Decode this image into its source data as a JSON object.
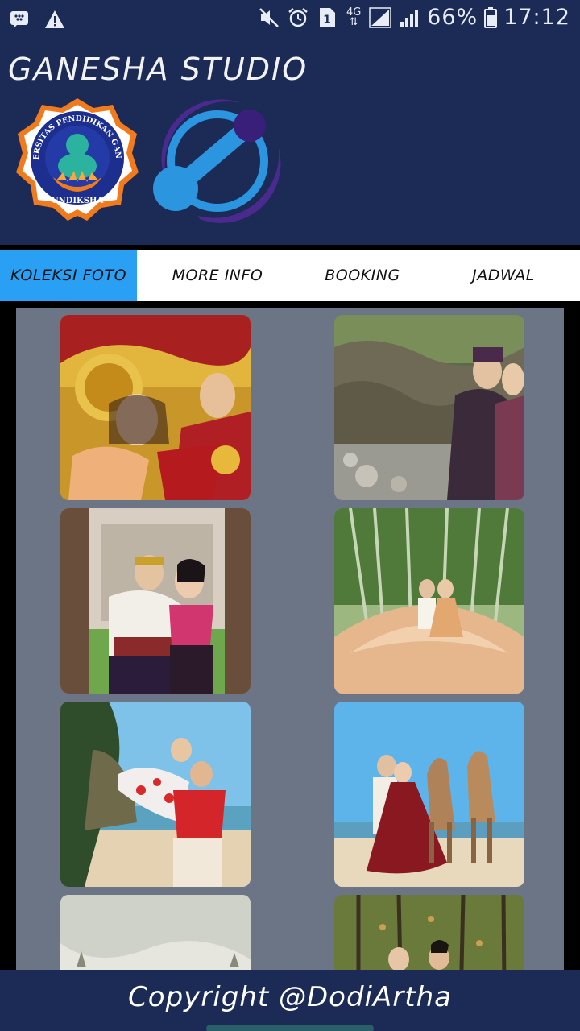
{
  "status_bar": {
    "battery_percent": "66%",
    "time": "17:12",
    "network": "4G",
    "sim_slot": "1",
    "icons": [
      "bbm-icon",
      "warning-icon",
      "mute-icon",
      "alarm-icon",
      "sim-icon",
      "signal-icon",
      "battery-icon"
    ]
  },
  "header": {
    "title": "GANESHA STUDIO",
    "logo_left": {
      "icon": "undiksha-logo",
      "ring_text": "UNIVERSITAS PENDIDIKAN GANESHA",
      "bottom_text": "UNDIKSHA"
    },
    "logo_right": {
      "icon": "app-logo"
    }
  },
  "tabs": [
    {
      "label": "KOLEKSI FOTO",
      "active": true
    },
    {
      "label": "MORE INFO",
      "active": false
    },
    {
      "label": "BOOKING",
      "active": false
    },
    {
      "label": "JADWAL",
      "active": false
    }
  ],
  "gallery": {
    "photos": [
      {
        "name": "balinese-couple-gold-costume"
      },
      {
        "name": "couple-rocky-river"
      },
      {
        "name": "couple-temple-gate"
      },
      {
        "name": "couple-bamboo-forest-dress"
      },
      {
        "name": "couple-beach-cliff"
      },
      {
        "name": "couple-beach-camels"
      },
      {
        "name": "photo-sky-trees"
      },
      {
        "name": "couple-autumn-forest"
      }
    ]
  },
  "footer": {
    "copyright": "Copyright @DodiArtha"
  },
  "colors": {
    "header_bg": "#1b2b55",
    "tab_active": "#2aa0f5",
    "gallery_bg": "#6c7586"
  }
}
